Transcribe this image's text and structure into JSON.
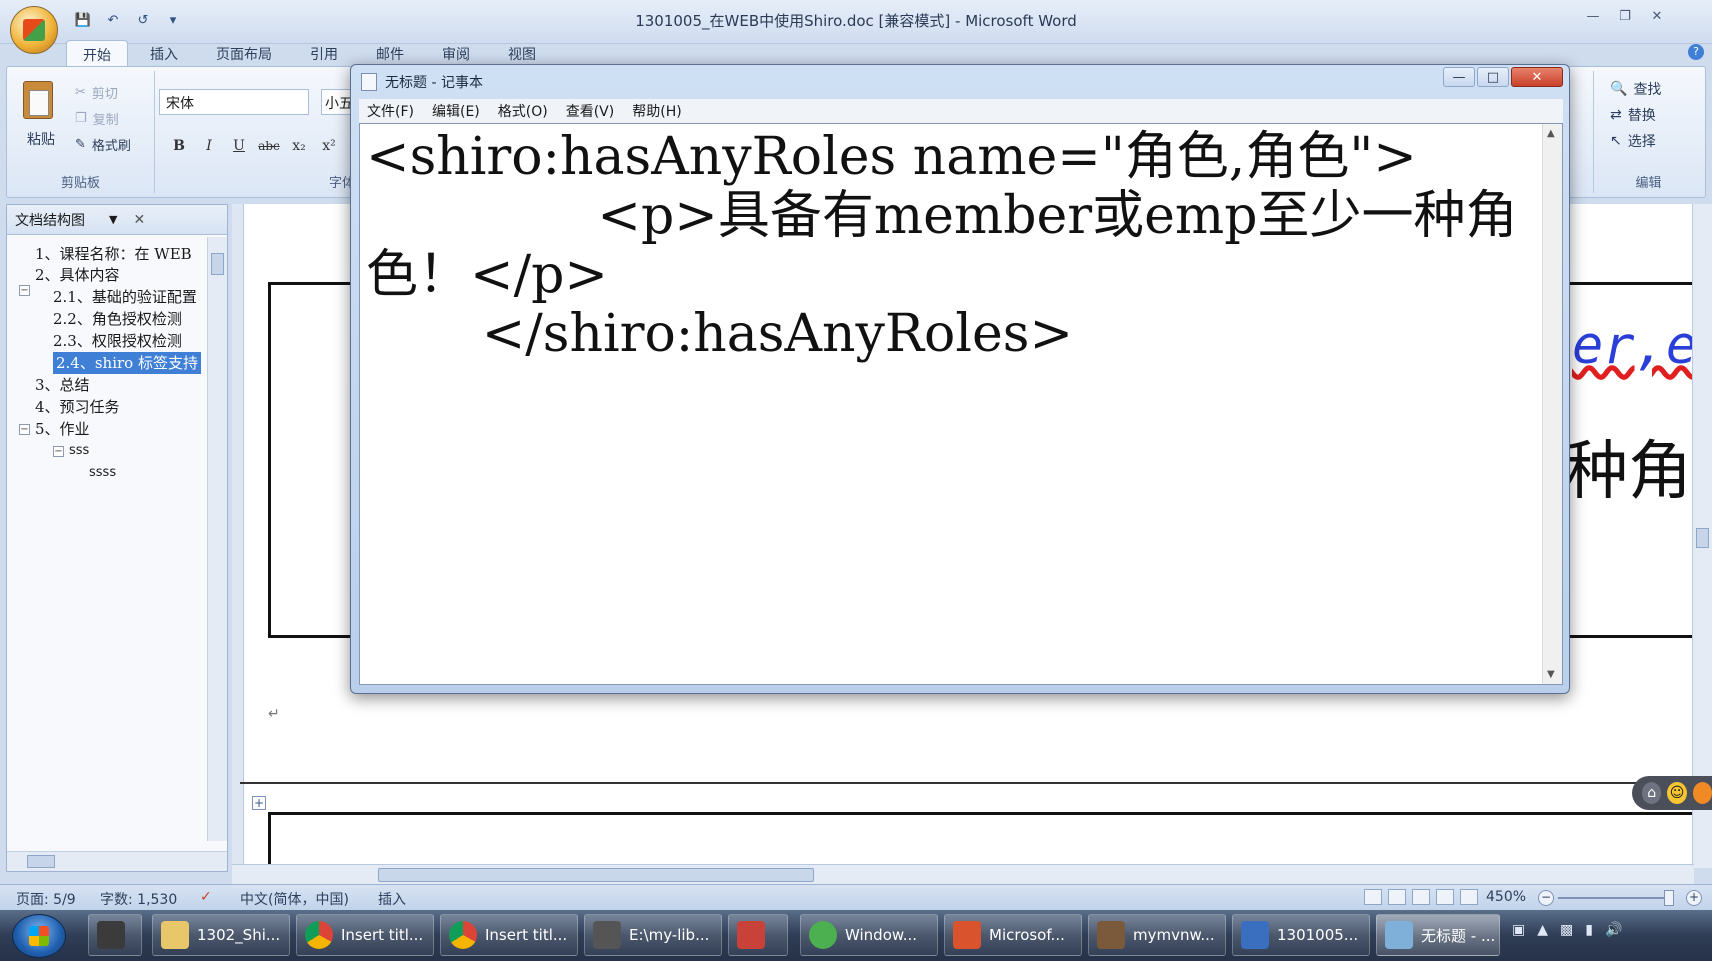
{
  "word": {
    "title": "1301005_在WEB中使用Shiro.doc [兼容模式] - Microsoft Word",
    "tabs": [
      "开始",
      "插入",
      "页面布局",
      "引用",
      "邮件",
      "审阅",
      "视图"
    ],
    "clipboard": {
      "paste": "粘贴",
      "cut": "剪切",
      "copy": "复制",
      "format_painter": "格式刷",
      "group_label": "剪贴板"
    },
    "font": {
      "name": "宋体",
      "size": "小五",
      "group_label": "字体"
    },
    "editing": {
      "find": "查找",
      "replace": "替换",
      "select": "选择",
      "group_label": "编辑"
    },
    "format_buttons": [
      "B",
      "I",
      "U",
      "abc",
      "x₂",
      "x²"
    ]
  },
  "navpane": {
    "title": "文档结构图",
    "items": [
      {
        "text": "1、课程名称：在 WEB"
      },
      {
        "text": "2、具体内容"
      },
      {
        "text": "2.1、基础的验证配置"
      },
      {
        "text": "2.2、角色授权检测"
      },
      {
        "text": "2.3、权限授权检测"
      },
      {
        "text": "2.4、shiro 标签支持"
      },
      {
        "text": "3、总结"
      },
      {
        "text": "4、预习任务"
      },
      {
        "text": "5、作业"
      },
      {
        "text": "sss"
      },
      {
        "text": "ssss"
      }
    ]
  },
  "document": {
    "visible_code": "er,e",
    "visible_cn": "种角"
  },
  "notepad": {
    "title": "无标题 - 记事本",
    "menu": [
      "文件(F)",
      "编辑(E)",
      "格式(O)",
      "查看(V)",
      "帮助(H)"
    ],
    "text": "<shiro:hasAnyRoles name=\"角色,角色\">\n              <p>具备有member或emp至少一种角色！</p>\n       </shiro:hasAnyRoles>"
  },
  "status": {
    "page": "页面: 5/9",
    "words": "字数: 1,530",
    "language": "中文(简体，中国)",
    "mode": "插入",
    "zoom": "450%"
  },
  "taskbar": {
    "items": [
      {
        "label": "1302_Shi...",
        "color": "#e8c66a"
      },
      {
        "label": "Insert titl...",
        "color": "#4aa3df"
      },
      {
        "label": "Insert titl...",
        "color": "#4aa3df"
      },
      {
        "label": "E:\\my-lib...",
        "color": "#6b6b6b"
      },
      {
        "label": "",
        "color": "#c8423a"
      },
      {
        "label": "Window...",
        "color": "#4caf50"
      },
      {
        "label": "Microsof...",
        "color": "#d9532c"
      },
      {
        "label": "mymvnw...",
        "color": "#7a5a3a"
      },
      {
        "label": "1301005...",
        "color": "#3a6fbf"
      },
      {
        "label": "无标题 - ...",
        "color": "#7fb0d9"
      }
    ]
  }
}
